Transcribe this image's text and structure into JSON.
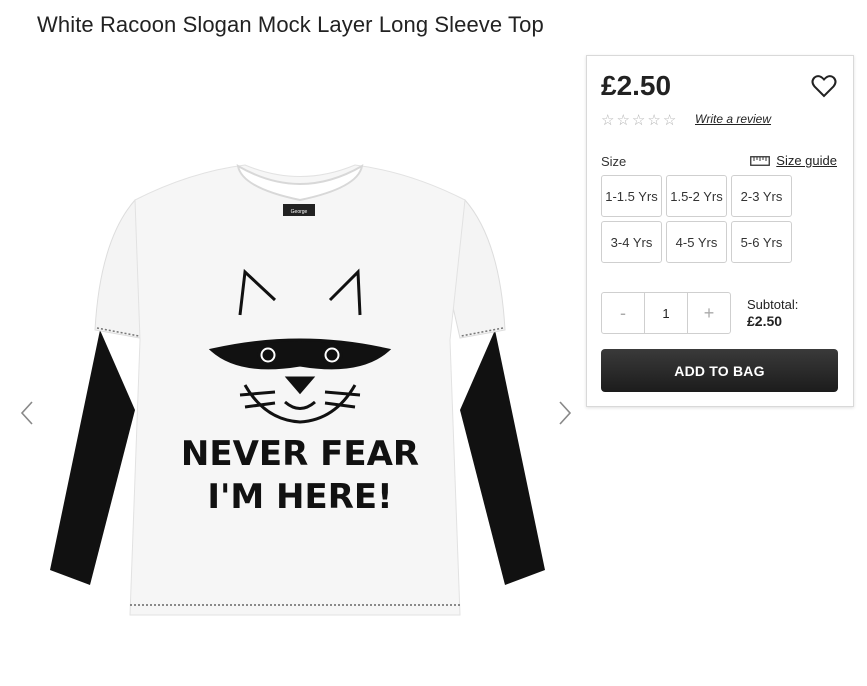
{
  "product": {
    "title": "White Racoon Slogan Mock Layer Long Sleeve Top",
    "image": {
      "alt": "White racoon slogan mock layer long sleeve top",
      "neck_label": "George",
      "slogan_line_1": "NEVER FEAR",
      "slogan_line_2": "I'M HERE!"
    }
  },
  "gallery": {
    "prev_icon": "chevron-left-icon",
    "next_icon": "chevron-right-icon"
  },
  "purchase": {
    "price": "£2.50",
    "wishlist_icon": "heart-icon",
    "rating": {
      "stars": 0,
      "max": 5
    },
    "review_link": "Write a review",
    "size_label": "Size",
    "size_guide_icon": "ruler-icon",
    "size_guide_label": "Size guide",
    "sizes": [
      "1-1.5 Yrs",
      "1.5-2 Yrs",
      "2-3 Yrs",
      "3-4 Yrs",
      "4-5 Yrs",
      "5-6 Yrs"
    ],
    "quantity": {
      "decrement": "-",
      "value": "1",
      "increment": "+"
    },
    "subtotal_label": "Subtotal:",
    "subtotal_value": "£2.50",
    "add_to_bag": "ADD TO BAG"
  },
  "colors": {
    "button_dark": "#222222",
    "border": "#cfcfcf"
  }
}
